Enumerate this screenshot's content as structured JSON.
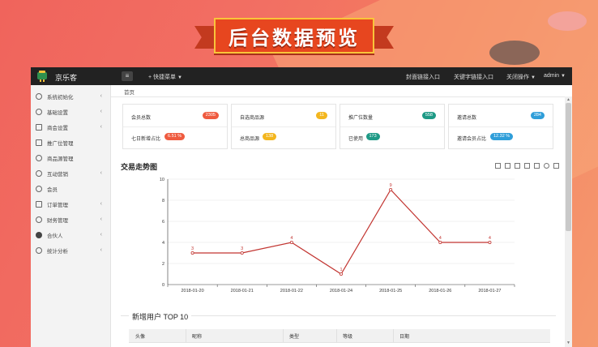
{
  "banner": {
    "title": "后台数据预览"
  },
  "topbar": {
    "brand": "京乐客",
    "quick_menu": "快捷菜单",
    "nav": [
      {
        "label": "封面链接入口"
      },
      {
        "label": "关键字链接入口"
      },
      {
        "label": "关闭操作"
      },
      {
        "label": "admin"
      }
    ]
  },
  "sidebar": {
    "items": [
      {
        "label": "系统初始化",
        "icon": "refresh-icon",
        "arrow": "‹"
      },
      {
        "label": "基础设置",
        "icon": "gear-icon",
        "arrow": "‹"
      },
      {
        "label": "商会设置",
        "icon": "layers-icon",
        "arrow": "‹"
      },
      {
        "label": "推广位管理",
        "icon": "barcode-icon",
        "arrow": ""
      },
      {
        "label": "商品源管理",
        "icon": "connect-icon",
        "arrow": ""
      },
      {
        "label": "互动营销",
        "icon": "hand-icon",
        "arrow": "‹"
      },
      {
        "label": "会员",
        "icon": "user-icon",
        "arrow": ""
      },
      {
        "label": "订单管理",
        "icon": "document-icon",
        "arrow": "‹"
      },
      {
        "label": "财务管理",
        "icon": "money-icon",
        "arrow": "‹"
      },
      {
        "label": "合伙人",
        "icon": "person-icon",
        "arrow": "‹"
      },
      {
        "label": "统计分析",
        "icon": "clock-icon",
        "arrow": "‹"
      }
    ]
  },
  "breadcrumb": {
    "current": "首页"
  },
  "stats": [
    {
      "label_a": "会员总数",
      "badge_a": "2305",
      "color_a": "#ef5b3f",
      "label_b": "七日新增占比",
      "badge_b": "6.51 %",
      "color_b": "#ef5b3f"
    },
    {
      "label_a": "自选商品源",
      "badge_a": "11",
      "color_a": "#f3b61e",
      "label_b": "总商品源",
      "badge_b": "138",
      "color_b": "#f3b61e"
    },
    {
      "label_a": "推广位数量",
      "badge_a": "558",
      "color_a": "#1e9a86",
      "label_b": "已使用",
      "badge_b": "173",
      "color_b": "#1e9a86"
    },
    {
      "label_a": "邀请总数",
      "badge_a": "284",
      "color_a": "#2f9ed9",
      "label_b": "邀请会员占比",
      "badge_b": "12.32 %",
      "color_b": "#2f9ed9"
    }
  ],
  "trend": {
    "title": "交易走势图"
  },
  "chart_data": {
    "type": "line",
    "x": [
      "2018-01-20",
      "2018-01-21",
      "2018-01-22",
      "2018-01-24",
      "2018-01-25",
      "2018-01-26",
      "2018-01-27"
    ],
    "values": [
      3,
      3,
      4,
      1,
      9,
      4,
      4
    ],
    "ylim": [
      0,
      10
    ],
    "yticks": [
      0,
      2,
      4,
      6,
      8,
      10
    ],
    "line_color": "#c23531",
    "grid": true
  },
  "top10": {
    "title": "新增用户 TOP 10",
    "headers": [
      "头像",
      "昵称",
      "类型",
      "等级",
      "日期"
    ]
  }
}
